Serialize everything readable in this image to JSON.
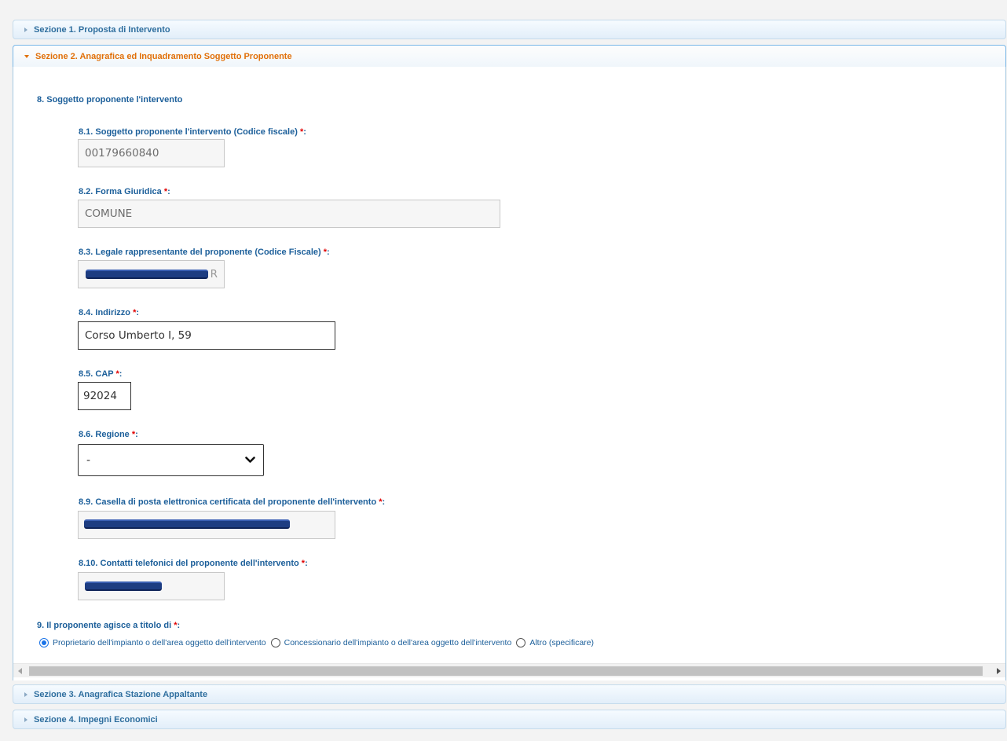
{
  "sections": {
    "s1": "Sezione 1. Proposta di Intervento",
    "s2": "Sezione 2. Anagrafica ed Inquadramento Soggetto Proponente",
    "s3": "Sezione 3. Anagrafica Stazione Appaltante",
    "s4": "Sezione 4. Impegni Economici"
  },
  "form": {
    "group8_title": "8. Soggetto proponente l'intervento",
    "required_mark": "*",
    "f81": {
      "label": "8.1. Soggetto proponente l'intervento (Codice fiscale)",
      "value": "00179660840"
    },
    "f82": {
      "label": "8.2. Forma Giuridica",
      "value": "COMUNE"
    },
    "f83": {
      "label": "8.3. Legale rappresentante del proponente (Codice Fiscale)",
      "value_tail": "R"
    },
    "f84": {
      "label": "8.4. Indirizzo",
      "value": "Corso Umberto I, 59"
    },
    "f85": {
      "label": "8.5. CAP",
      "value": "92024"
    },
    "f86": {
      "label": "8.6. Regione",
      "value": "-"
    },
    "f89": {
      "label": "8.9. Casella di posta elettronica certificata del proponente dell'intervento"
    },
    "f810": {
      "label": "8.10. Contatti telefonici del proponente dell'intervento"
    },
    "q9": {
      "label": "9. Il proponente agisce a titolo di",
      "options": [
        "Proprietario dell'impianto o dell'area oggetto dell'intervento",
        "Concessionario dell'impianto o dell'area oggetto dell'intervento",
        "Altro (specificare)"
      ],
      "selected": 0
    }
  },
  "icons": {
    "collapsed": "triangle-right-icon",
    "expanded": "triangle-down-icon",
    "select": "chevron-down-icon",
    "scroll_left": "scroll-left-arrow-icon",
    "scroll_right": "scroll-right-arrow-icon"
  },
  "colors": {
    "label_blue": "#1c5f9a",
    "active_orange": "#e17009",
    "required_red": "#e00000",
    "radio_blue": "#1a73e8"
  }
}
